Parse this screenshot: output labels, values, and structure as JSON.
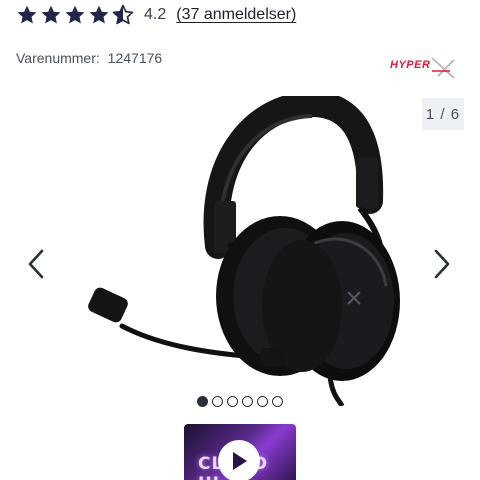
{
  "rating": {
    "value": "4.2",
    "stars_filled": 4,
    "stars_total": 5,
    "star_fraction": 0.5,
    "review_count_text": "(37 anmeldelser)",
    "star_color": "#23264a"
  },
  "product": {
    "sku_label": "Varenummer:",
    "sku_value": "1247176",
    "brand_logo": "HyperX",
    "brand_color": "#e31837"
  },
  "gallery": {
    "counter": "1 / 6",
    "image_subject": "headset-image",
    "prev_icon": "chevron-left-icon",
    "next_icon": "chevron-right-icon",
    "dots_total": 6,
    "dots_active_index": 0
  },
  "video": {
    "title": "CLOUD III",
    "play_icon": "play-icon"
  }
}
